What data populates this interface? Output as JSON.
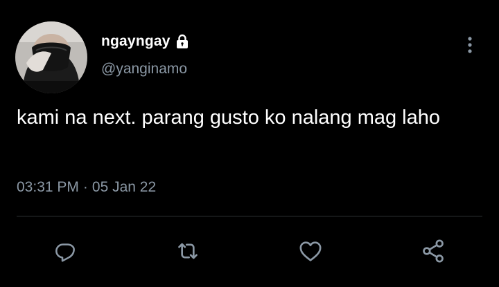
{
  "author": {
    "display_name": "ngayngay",
    "handle": "@yanginamo",
    "protected_icon": "lock-icon",
    "avatar_icon": "masked-person-avatar"
  },
  "tweet": {
    "text": "kami na next. parang gusto ko nalang mag laho",
    "time": "03:31 PM",
    "separator": "·",
    "date": "05 Jan 22"
  },
  "actions": [
    {
      "name": "reply",
      "icon": "reply-icon"
    },
    {
      "name": "retweet",
      "icon": "retweet-icon"
    },
    {
      "name": "like",
      "icon": "heart-icon"
    },
    {
      "name": "share",
      "icon": "share-icon"
    }
  ],
  "colors": {
    "background": "#000000",
    "text_primary": "#ffffff",
    "text_secondary": "#8b98a5",
    "divider": "#2f3336"
  }
}
